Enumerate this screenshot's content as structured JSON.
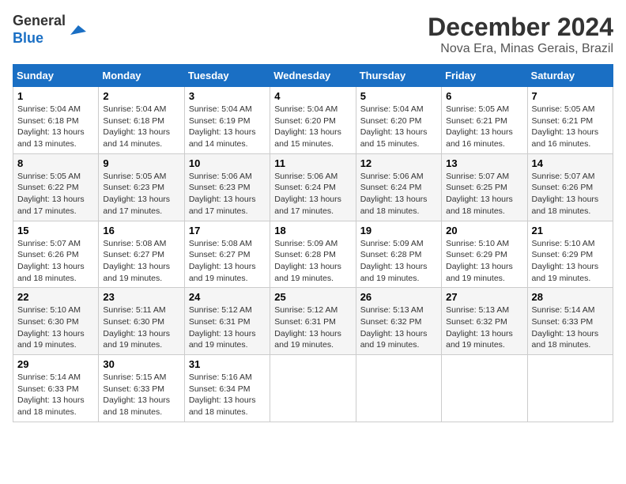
{
  "logo": {
    "general": "General",
    "blue": "Blue"
  },
  "header": {
    "month_year": "December 2024",
    "location": "Nova Era, Minas Gerais, Brazil"
  },
  "weekdays": [
    "Sunday",
    "Monday",
    "Tuesday",
    "Wednesday",
    "Thursday",
    "Friday",
    "Saturday"
  ],
  "weeks": [
    [
      {
        "day": "1",
        "sunrise": "5:04 AM",
        "sunset": "6:18 PM",
        "daylight": "13 hours and 13 minutes."
      },
      {
        "day": "2",
        "sunrise": "5:04 AM",
        "sunset": "6:18 PM",
        "daylight": "13 hours and 14 minutes."
      },
      {
        "day": "3",
        "sunrise": "5:04 AM",
        "sunset": "6:19 PM",
        "daylight": "13 hours and 14 minutes."
      },
      {
        "day": "4",
        "sunrise": "5:04 AM",
        "sunset": "6:20 PM",
        "daylight": "13 hours and 15 minutes."
      },
      {
        "day": "5",
        "sunrise": "5:04 AM",
        "sunset": "6:20 PM",
        "daylight": "13 hours and 15 minutes."
      },
      {
        "day": "6",
        "sunrise": "5:05 AM",
        "sunset": "6:21 PM",
        "daylight": "13 hours and 16 minutes."
      },
      {
        "day": "7",
        "sunrise": "5:05 AM",
        "sunset": "6:21 PM",
        "daylight": "13 hours and 16 minutes."
      }
    ],
    [
      {
        "day": "8",
        "sunrise": "5:05 AM",
        "sunset": "6:22 PM",
        "daylight": "13 hours and 17 minutes."
      },
      {
        "day": "9",
        "sunrise": "5:05 AM",
        "sunset": "6:23 PM",
        "daylight": "13 hours and 17 minutes."
      },
      {
        "day": "10",
        "sunrise": "5:06 AM",
        "sunset": "6:23 PM",
        "daylight": "13 hours and 17 minutes."
      },
      {
        "day": "11",
        "sunrise": "5:06 AM",
        "sunset": "6:24 PM",
        "daylight": "13 hours and 17 minutes."
      },
      {
        "day": "12",
        "sunrise": "5:06 AM",
        "sunset": "6:24 PM",
        "daylight": "13 hours and 18 minutes."
      },
      {
        "day": "13",
        "sunrise": "5:07 AM",
        "sunset": "6:25 PM",
        "daylight": "13 hours and 18 minutes."
      },
      {
        "day": "14",
        "sunrise": "5:07 AM",
        "sunset": "6:26 PM",
        "daylight": "13 hours and 18 minutes."
      }
    ],
    [
      {
        "day": "15",
        "sunrise": "5:07 AM",
        "sunset": "6:26 PM",
        "daylight": "13 hours and 18 minutes."
      },
      {
        "day": "16",
        "sunrise": "5:08 AM",
        "sunset": "6:27 PM",
        "daylight": "13 hours and 19 minutes."
      },
      {
        "day": "17",
        "sunrise": "5:08 AM",
        "sunset": "6:27 PM",
        "daylight": "13 hours and 19 minutes."
      },
      {
        "day": "18",
        "sunrise": "5:09 AM",
        "sunset": "6:28 PM",
        "daylight": "13 hours and 19 minutes."
      },
      {
        "day": "19",
        "sunrise": "5:09 AM",
        "sunset": "6:28 PM",
        "daylight": "13 hours and 19 minutes."
      },
      {
        "day": "20",
        "sunrise": "5:10 AM",
        "sunset": "6:29 PM",
        "daylight": "13 hours and 19 minutes."
      },
      {
        "day": "21",
        "sunrise": "5:10 AM",
        "sunset": "6:29 PM",
        "daylight": "13 hours and 19 minutes."
      }
    ],
    [
      {
        "day": "22",
        "sunrise": "5:10 AM",
        "sunset": "6:30 PM",
        "daylight": "13 hours and 19 minutes."
      },
      {
        "day": "23",
        "sunrise": "5:11 AM",
        "sunset": "6:30 PM",
        "daylight": "13 hours and 19 minutes."
      },
      {
        "day": "24",
        "sunrise": "5:12 AM",
        "sunset": "6:31 PM",
        "daylight": "13 hours and 19 minutes."
      },
      {
        "day": "25",
        "sunrise": "5:12 AM",
        "sunset": "6:31 PM",
        "daylight": "13 hours and 19 minutes."
      },
      {
        "day": "26",
        "sunrise": "5:13 AM",
        "sunset": "6:32 PM",
        "daylight": "13 hours and 19 minutes."
      },
      {
        "day": "27",
        "sunrise": "5:13 AM",
        "sunset": "6:32 PM",
        "daylight": "13 hours and 19 minutes."
      },
      {
        "day": "28",
        "sunrise": "5:14 AM",
        "sunset": "6:33 PM",
        "daylight": "13 hours and 18 minutes."
      }
    ],
    [
      {
        "day": "29",
        "sunrise": "5:14 AM",
        "sunset": "6:33 PM",
        "daylight": "13 hours and 18 minutes."
      },
      {
        "day": "30",
        "sunrise": "5:15 AM",
        "sunset": "6:33 PM",
        "daylight": "13 hours and 18 minutes."
      },
      {
        "day": "31",
        "sunrise": "5:16 AM",
        "sunset": "6:34 PM",
        "daylight": "13 hours and 18 minutes."
      },
      null,
      null,
      null,
      null
    ]
  ]
}
